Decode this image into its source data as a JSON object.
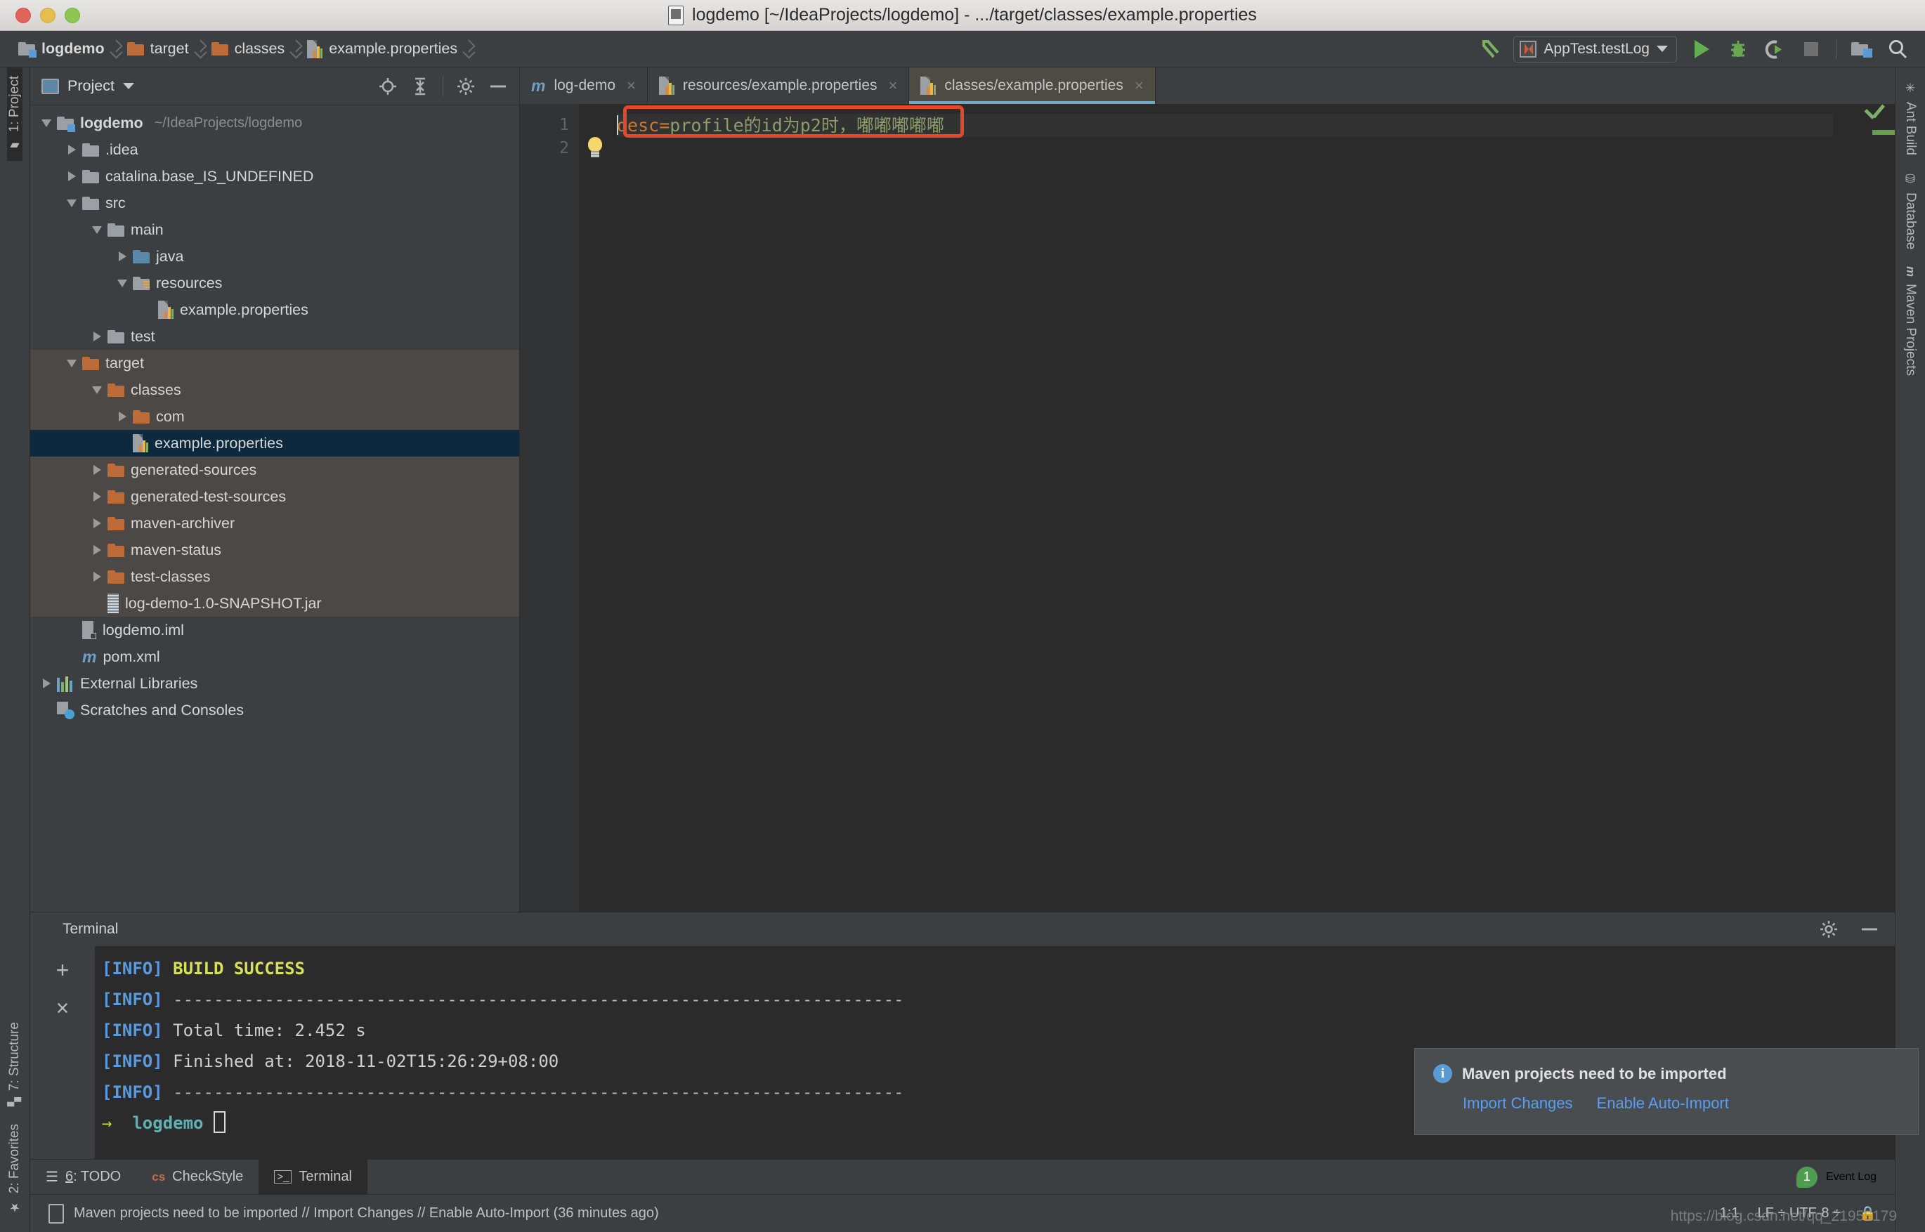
{
  "window": {
    "title": "logdemo [~/IdeaProjects/logdemo] - .../target/classes/example.properties",
    "doc_icon": "java-file-icon"
  },
  "breadcrumb": {
    "items": [
      {
        "label": "logdemo",
        "icon": "module-folder-icon"
      },
      {
        "label": "target",
        "icon": "orange-folder-icon"
      },
      {
        "label": "classes",
        "icon": "orange-folder-icon"
      },
      {
        "label": "example.properties",
        "icon": "properties-file-icon"
      }
    ]
  },
  "toolbar": {
    "back_icon": "back-arrow-icon",
    "run_config": "AppTest.testLog",
    "run_icon": "run-icon",
    "debug_icon": "debug-icon",
    "coverage_icon": "run-with-coverage-icon",
    "stop_icon": "stop-icon",
    "project_structure_icon": "project-structure-icon",
    "search_icon": "search-everywhere-icon"
  },
  "left_strip": {
    "top": [
      {
        "label": "1: Project",
        "icon": "project-icon",
        "active": true
      }
    ],
    "bottom": [
      {
        "label": "7: Structure",
        "icon": "structure-icon"
      },
      {
        "label": "2: Favorites",
        "icon": "star-icon"
      }
    ]
  },
  "right_strip": {
    "items": [
      {
        "label": "Ant Build",
        "icon": "ant-icon"
      },
      {
        "label": "Database",
        "icon": "database-icon"
      },
      {
        "label": "Maven Projects",
        "icon": "maven-icon"
      }
    ]
  },
  "project_pane": {
    "title": "Project",
    "dropdown_icon": "chevron-down-icon",
    "locate_icon": "scroll-from-source-icon",
    "collapse_icon": "collapse-all-icon",
    "settings_icon": "gear-icon",
    "hide_icon": "hide-icon",
    "tree": [
      {
        "label": "logdemo",
        "path": "~/IdeaProjects/logdemo",
        "indent": 0,
        "twisty": "down",
        "icon": "module-folder",
        "bold": true,
        "state": "normal"
      },
      {
        "label": ".idea",
        "indent": 1,
        "twisty": "right",
        "icon": "folder-gray",
        "state": "normal"
      },
      {
        "label": "catalina.base_IS_UNDEFINED",
        "indent": 1,
        "twisty": "right",
        "icon": "folder-gray",
        "state": "normal"
      },
      {
        "label": "src",
        "indent": 1,
        "twisty": "down",
        "icon": "folder-gray",
        "state": "normal"
      },
      {
        "label": "main",
        "indent": 2,
        "twisty": "down",
        "icon": "folder-gray",
        "state": "normal"
      },
      {
        "label": "java",
        "indent": 3,
        "twisty": "right",
        "icon": "folder-blue",
        "state": "normal"
      },
      {
        "label": "resources",
        "indent": 3,
        "twisty": "down",
        "icon": "folder-resources",
        "state": "normal"
      },
      {
        "label": "example.properties",
        "indent": 4,
        "twisty": "none",
        "icon": "properties-file",
        "state": "normal"
      },
      {
        "label": "test",
        "indent": 2,
        "twisty": "right",
        "icon": "folder-gray",
        "state": "normal"
      },
      {
        "label": "target",
        "indent": 1,
        "twisty": "down",
        "icon": "folder-orange",
        "state": "highlight"
      },
      {
        "label": "classes",
        "indent": 2,
        "twisty": "down",
        "icon": "folder-orange",
        "state": "highlight"
      },
      {
        "label": "com",
        "indent": 3,
        "twisty": "right",
        "icon": "folder-orange",
        "state": "highlight"
      },
      {
        "label": "example.properties",
        "indent": 3,
        "twisty": "none",
        "icon": "properties-file",
        "state": "selected"
      },
      {
        "label": "generated-sources",
        "indent": 2,
        "twisty": "right",
        "icon": "folder-orange",
        "state": "highlight"
      },
      {
        "label": "generated-test-sources",
        "indent": 2,
        "twisty": "right",
        "icon": "folder-orange",
        "state": "highlight"
      },
      {
        "label": "maven-archiver",
        "indent": 2,
        "twisty": "right",
        "icon": "folder-orange",
        "state": "highlight"
      },
      {
        "label": "maven-status",
        "indent": 2,
        "twisty": "right",
        "icon": "folder-orange",
        "state": "highlight"
      },
      {
        "label": "test-classes",
        "indent": 2,
        "twisty": "right",
        "icon": "folder-orange",
        "state": "highlight"
      },
      {
        "label": "log-demo-1.0-SNAPSHOT.jar",
        "indent": 2,
        "twisty": "none",
        "icon": "jar-file",
        "state": "highlight"
      },
      {
        "label": "logdemo.iml",
        "indent": 1,
        "twisty": "none",
        "icon": "iml-file",
        "state": "normal"
      },
      {
        "label": "pom.xml",
        "indent": 1,
        "twisty": "none",
        "icon": "maven-m",
        "state": "normal"
      },
      {
        "label": "External Libraries",
        "indent": 0,
        "twisty": "right",
        "icon": "libraries",
        "state": "normal"
      },
      {
        "label": "Scratches and Consoles",
        "indent": 0,
        "twisty": "none",
        "icon": "scratches",
        "state": "normal"
      }
    ]
  },
  "editor": {
    "tabs": [
      {
        "label": "log-demo",
        "icon": "maven-m",
        "active": false
      },
      {
        "label": "resources/example.properties",
        "icon": "properties-file",
        "active": false
      },
      {
        "label": "classes/example.properties",
        "icon": "properties-file",
        "active": true
      }
    ],
    "close_label": "×",
    "line_numbers": [
      "1",
      "2"
    ],
    "lines": [
      {
        "key": "desc",
        "eq": "=",
        "value": "profile的id为p2时，嘟嘟嘟嘟嘟"
      },
      {
        "key": "",
        "eq": "",
        "value": ""
      }
    ],
    "intention_icon": "light-bulb-icon",
    "inspection_status_icon": "no-errors-checkmark",
    "annotation": {
      "type": "red-rectangle",
      "color": "#e8452b"
    }
  },
  "terminal": {
    "title": "Terminal",
    "new_session_label": "+",
    "close_session_label": "×",
    "settings_icon": "gear-icon",
    "hide_icon": "hide-icon",
    "lines": [
      {
        "prefix": "[INFO]",
        "text": "BUILD SUCCESS",
        "style": "success"
      },
      {
        "prefix": "[INFO]",
        "text": "------------------------------------------------------------------------",
        "style": "dash"
      },
      {
        "prefix": "[INFO]",
        "text": "Total time: 2.452 s",
        "style": "plain"
      },
      {
        "prefix": "[INFO]",
        "text": "Finished at: 2018-11-02T15:26:29+08:00",
        "style": "plain"
      },
      {
        "prefix": "[INFO]",
        "text": "------------------------------------------------------------------------",
        "style": "dash"
      }
    ],
    "prompt_arrow": "→",
    "prompt_dir": "logdemo"
  },
  "bottom_tabs": {
    "items": [
      {
        "label": "6: TODO",
        "num": "6",
        "rest": ": TODO",
        "icon": "todo-icon",
        "active": false
      },
      {
        "label": "CheckStyle",
        "icon": "checkstyle-icon",
        "active": false
      },
      {
        "label": "Terminal",
        "icon": "terminal-icon",
        "active": true
      }
    ],
    "event_log": {
      "label": "Event Log",
      "count": "1"
    }
  },
  "status_bar": {
    "message": "Maven projects need to be imported // Import Changes // Enable Auto-Import (36 minutes ago)",
    "caret": "1:1",
    "encoding": "LF ÷ UTF-8 ÷",
    "lock_icon": "lock-icon",
    "watermark": "https://blog.csdn.net/qq_21955179"
  },
  "notification": {
    "icon": "info-icon",
    "title": "Maven projects need to be imported",
    "actions": [
      "Import Changes",
      "Enable Auto-Import"
    ]
  },
  "colors": {
    "accent_blue": "#589df6",
    "annotation_red": "#e8452b",
    "terminal_info": "#5c9ae0",
    "terminal_success": "#d8e05a",
    "selection": "#0d293e"
  }
}
